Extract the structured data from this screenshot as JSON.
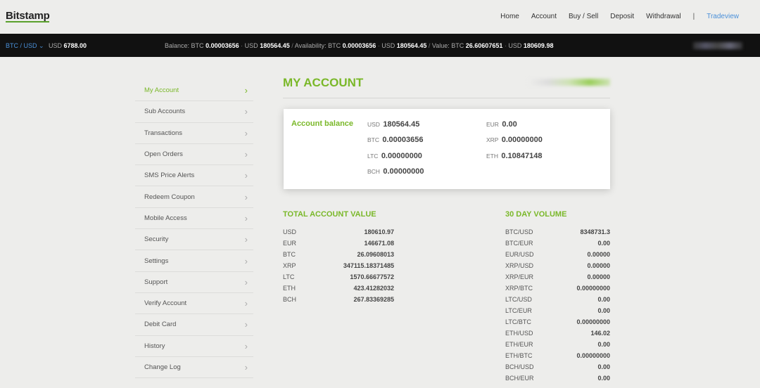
{
  "header": {
    "logo": "Bitstamp",
    "nav": [
      "Home",
      "Account",
      "Buy / Sell",
      "Deposit",
      "Withdrawal"
    ],
    "separator": "|",
    "tradeview": "Tradeview"
  },
  "ticker": {
    "pair": "BTC / USD",
    "price_currency": "USD",
    "price": "6788.00",
    "balance_label": "Balance:",
    "balance_btc_cur": "BTC",
    "balance_btc": "0.00003656",
    "balance_usd_cur": "USD",
    "balance_usd": "180564.45",
    "availability_label": "Availability:",
    "avail_btc_cur": "BTC",
    "avail_btc": "0.00003656",
    "avail_usd_cur": "USD",
    "avail_usd": "180564.45",
    "value_label": "Value:",
    "value_btc_cur": "BTC",
    "value_btc": "26.60607651",
    "value_usd_cur": "USD",
    "value_usd": "180609.98"
  },
  "sidebar": {
    "items": [
      {
        "label": "My Account",
        "active": true
      },
      {
        "label": "Sub Accounts"
      },
      {
        "label": "Transactions"
      },
      {
        "label": "Open Orders"
      },
      {
        "label": "SMS Price Alerts"
      },
      {
        "label": "Redeem Coupon"
      },
      {
        "label": "Mobile Access"
      },
      {
        "label": "Security"
      },
      {
        "label": "Settings"
      },
      {
        "label": "Support"
      },
      {
        "label": "Verify Account"
      },
      {
        "label": "Debit Card"
      },
      {
        "label": "History"
      },
      {
        "label": "Change Log"
      }
    ]
  },
  "main": {
    "title": "MY ACCOUNT",
    "balance": {
      "label": "Account balance",
      "items": [
        {
          "cur": "USD",
          "val": "180564.45"
        },
        {
          "cur": "EUR",
          "val": "0.00"
        },
        {
          "cur": "BTC",
          "val": "0.00003656"
        },
        {
          "cur": "XRP",
          "val": "0.00000000"
        },
        {
          "cur": "LTC",
          "val": "0.00000000"
        },
        {
          "cur": "ETH",
          "val": "0.10847148"
        },
        {
          "cur": "BCH",
          "val": "0.00000000"
        }
      ]
    },
    "total_value": {
      "title": "TOTAL ACCOUNT VALUE",
      "rows": [
        {
          "k": "USD",
          "v": "180610.97"
        },
        {
          "k": "EUR",
          "v": "146671.08"
        },
        {
          "k": "BTC",
          "v": "26.09608013"
        },
        {
          "k": "XRP",
          "v": "347115.18371485"
        },
        {
          "k": "LTC",
          "v": "1570.66677572"
        },
        {
          "k": "ETH",
          "v": "423.41282032"
        },
        {
          "k": "BCH",
          "v": "267.83369285"
        }
      ]
    },
    "volume": {
      "title": "30 DAY VOLUME",
      "rows": [
        {
          "k": "BTC/USD",
          "v": "8348731.3"
        },
        {
          "k": "BTC/EUR",
          "v": "0.00"
        },
        {
          "k": "EUR/USD",
          "v": "0.00000"
        },
        {
          "k": "XRP/USD",
          "v": "0.00000"
        },
        {
          "k": "XRP/EUR",
          "v": "0.00000"
        },
        {
          "k": "XRP/BTC",
          "v": "0.00000000"
        },
        {
          "k": "LTC/USD",
          "v": "0.00"
        },
        {
          "k": "LTC/EUR",
          "v": "0.00"
        },
        {
          "k": "LTC/BTC",
          "v": "0.00000000"
        },
        {
          "k": "ETH/USD",
          "v": "146.02"
        },
        {
          "k": "ETH/EUR",
          "v": "0.00"
        },
        {
          "k": "ETH/BTC",
          "v": "0.00000000"
        },
        {
          "k": "BCH/USD",
          "v": "0.00"
        },
        {
          "k": "BCH/EUR",
          "v": "0.00"
        }
      ]
    }
  }
}
